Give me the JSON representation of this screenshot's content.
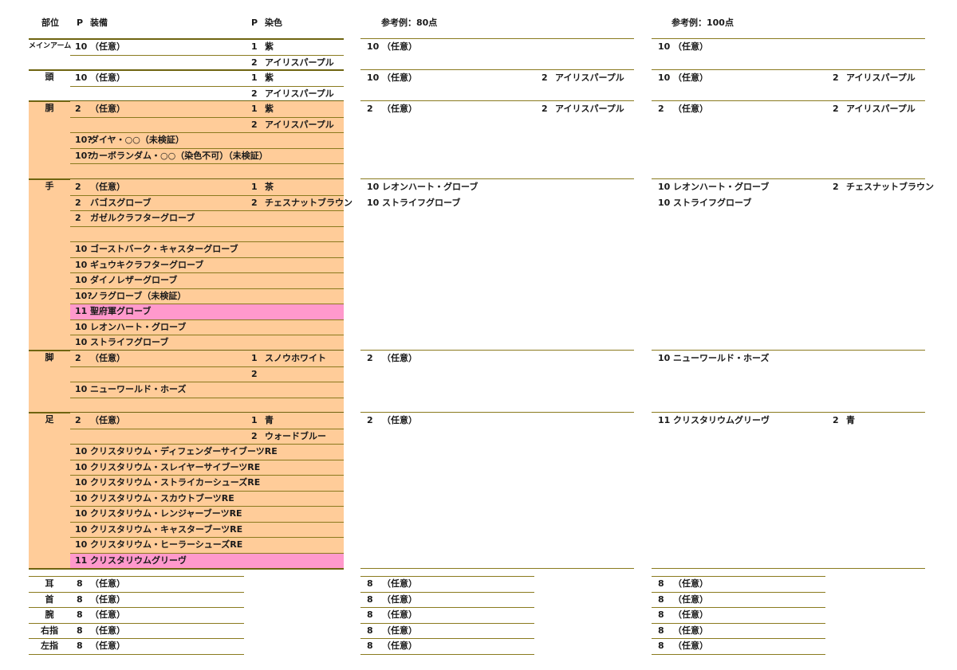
{
  "header": {
    "part": "部位",
    "p": "P",
    "equip": "装備",
    "p2": "P",
    "dye": "染色",
    "ref80": "参考例：80点",
    "ref100": "参考例：100点"
  },
  "sections": [
    {
      "part": "メインアーム",
      "rows": [
        {
          "p": "10",
          "equip": "（任意）",
          "dp": "1",
          "dye": "紫"
        },
        {
          "p": "",
          "equip": "",
          "dp": "2",
          "dye": "アイリスパープル"
        }
      ],
      "ref80": [
        {
          "p": "10",
          "equip": "（任意）",
          "dp": "",
          "dye": ""
        }
      ],
      "ref100": [
        {
          "p": "10",
          "equip": "（任意）",
          "dp": "",
          "dye": ""
        }
      ]
    },
    {
      "part": "頭",
      "rows": [
        {
          "p": "10",
          "equip": "（任意）",
          "dp": "1",
          "dye": "紫"
        },
        {
          "p": "",
          "equip": "",
          "dp": "2",
          "dye": "アイリスパープル"
        }
      ],
      "ref80": [
        {
          "p": "10",
          "equip": "（任意）",
          "dp": "2",
          "dye": "アイリスパープル"
        }
      ],
      "ref100": [
        {
          "p": "10",
          "equip": "（任意）",
          "dp": "2",
          "dye": "アイリスパープル"
        }
      ]
    },
    {
      "part": "胴",
      "rows": [
        {
          "p": "2",
          "equip": "（任意）",
          "dp": "1",
          "dye": "紫"
        },
        {
          "p": "",
          "equip": "",
          "dp": "2",
          "dye": "アイリスパープル"
        },
        {
          "p": "10?",
          "equip": "ダイヤ・○○（未検証）",
          "dp": "",
          "dye": ""
        },
        {
          "p": "10?",
          "equip": "カーボランダム・○○（染色不可）（未検証）",
          "dp": "",
          "dye": ""
        },
        {
          "p": "",
          "equip": "",
          "dp": "",
          "dye": ""
        }
      ],
      "ref80": [
        {
          "p": "2",
          "equip": "（任意）",
          "dp": "2",
          "dye": "アイリスパープル"
        }
      ],
      "ref100": [
        {
          "p": "2",
          "equip": "（任意）",
          "dp": "2",
          "dye": "アイリスパープル"
        }
      ]
    },
    {
      "part": "手",
      "rows": [
        {
          "p": "2",
          "equip": "（任意）",
          "dp": "1",
          "dye": "茶"
        },
        {
          "p": "2",
          "equip": "バゴスグローブ",
          "dp": "2",
          "dye": "チェスナットブラウン"
        },
        {
          "p": "2",
          "equip": "ガゼルクラフターグローブ",
          "dp": "",
          "dye": ""
        },
        {
          "p": "",
          "equip": "",
          "dp": "",
          "dye": ""
        },
        {
          "p": "10",
          "equip": "ゴーストバーク・キャスターグローブ",
          "dp": "",
          "dye": ""
        },
        {
          "p": "10",
          "equip": "ギュウキクラフターグローブ",
          "dp": "",
          "dye": ""
        },
        {
          "p": "10",
          "equip": "ダイノレザーグローブ",
          "dp": "",
          "dye": ""
        },
        {
          "p": "10?",
          "equip": "ノラグローブ（未検証）",
          "dp": "",
          "dye": ""
        },
        {
          "p": "11",
          "equip": "聖府軍グローブ",
          "dp": "",
          "dye": "",
          "pink": true
        },
        {
          "p": "10",
          "equip": "レオンハート・グローブ",
          "dp": "",
          "dye": ""
        },
        {
          "p": "10",
          "equip": "ストライフグローブ",
          "dp": "",
          "dye": ""
        }
      ],
      "ref80": [
        {
          "p": "10",
          "equip": "レオンハート・グローブ",
          "dp": "",
          "dye": ""
        },
        {
          "p": "10",
          "equip": "ストライフグローブ",
          "dp": "",
          "dye": ""
        }
      ],
      "ref100": [
        {
          "p": "10",
          "equip": "レオンハート・グローブ",
          "dp": "2",
          "dye": "チェスナットブラウン"
        },
        {
          "p": "10",
          "equip": "ストライフグローブ",
          "dp": "",
          "dye": ""
        }
      ]
    },
    {
      "part": "脚",
      "rows": [
        {
          "p": "2",
          "equip": "（任意）",
          "dp": "1",
          "dye": "スノウホワイト"
        },
        {
          "p": "",
          "equip": "",
          "dp": "2",
          "dye": ""
        },
        {
          "p": "10",
          "equip": "ニューワールド・ホーズ",
          "dp": "",
          "dye": ""
        },
        {
          "p": "",
          "equip": "",
          "dp": "",
          "dye": ""
        }
      ],
      "ref80": [
        {
          "p": "2",
          "equip": "（任意）",
          "dp": "",
          "dye": ""
        }
      ],
      "ref100": [
        {
          "p": "10",
          "equip": "ニューワールド・ホーズ",
          "dp": "",
          "dye": ""
        }
      ]
    },
    {
      "part": "足",
      "rows": [
        {
          "p": "2",
          "equip": "（任意）",
          "dp": "1",
          "dye": "青"
        },
        {
          "p": "",
          "equip": "",
          "dp": "2",
          "dye": "ウォードブルー"
        },
        {
          "p": "10",
          "equip": "クリスタリウム・ディフェンダーサイブーツRE",
          "dp": "",
          "dye": ""
        },
        {
          "p": "10",
          "equip": "クリスタリウム・スレイヤーサイブーツRE",
          "dp": "",
          "dye": ""
        },
        {
          "p": "10",
          "equip": "クリスタリウム・ストライカーシューズRE",
          "dp": "",
          "dye": ""
        },
        {
          "p": "10",
          "equip": "クリスタリウム・スカウトブーツRE",
          "dp": "",
          "dye": ""
        },
        {
          "p": "10",
          "equip": "クリスタリウム・レンジャーブーツRE",
          "dp": "",
          "dye": ""
        },
        {
          "p": "10",
          "equip": "クリスタリウム・キャスターブーツRE",
          "dp": "",
          "dye": ""
        },
        {
          "p": "10",
          "equip": "クリスタリウム・ヒーラーシューズRE",
          "dp": "",
          "dye": ""
        },
        {
          "p": "11",
          "equip": "クリスタリウムグリーヴ",
          "dp": "",
          "dye": "",
          "pink": true
        }
      ],
      "ref80": [
        {
          "p": "2",
          "equip": "（任意）",
          "dp": "",
          "dye": ""
        }
      ],
      "ref100": [
        {
          "p": "11",
          "equip": "クリスタリウムグリーヴ",
          "dp": "2",
          "dye": "青"
        }
      ]
    }
  ],
  "accessories": [
    {
      "part": "耳",
      "p": "8",
      "equip": "（任意）"
    },
    {
      "part": "首",
      "p": "8",
      "equip": "（任意）"
    },
    {
      "part": "腕",
      "p": "8",
      "equip": "（任意）"
    },
    {
      "part": "右指",
      "p": "8",
      "equip": "（任意）"
    },
    {
      "part": "左指",
      "p": "8",
      "equip": "（任意）"
    }
  ],
  "ref80_accessories": [
    {
      "p": "8",
      "equip": "（任意）"
    },
    {
      "p": "8",
      "equip": "（任意）"
    },
    {
      "p": "8",
      "equip": "（任意）"
    },
    {
      "p": "8",
      "equip": "（任意）"
    },
    {
      "p": "8",
      "equip": "（任意）"
    }
  ],
  "ref100_accessories": [
    {
      "p": "8",
      "equip": "（任意）"
    },
    {
      "p": "8",
      "equip": "（任意）"
    },
    {
      "p": "8",
      "equip": "（任意）"
    },
    {
      "p": "8",
      "equip": "（任意）"
    },
    {
      "p": "8",
      "equip": "（任意）"
    }
  ],
  "colors": {
    "peach": "#ffcc99",
    "pink": "#ff99cc",
    "rule": "#8a7a1e"
  }
}
